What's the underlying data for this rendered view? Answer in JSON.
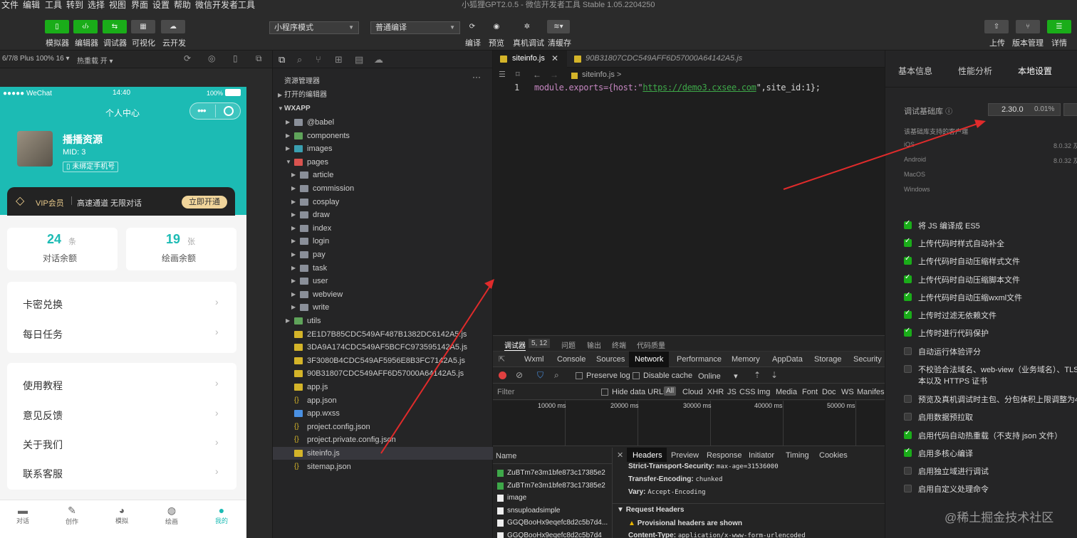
{
  "menu": [
    "文件",
    "编辑",
    "工具",
    "转到",
    "选择",
    "视图",
    "界面",
    "设置",
    "帮助",
    "微信开发者工具"
  ],
  "window_title": "小狐狸GPT2.0.5 - 微信开发者工具 Stable 1.05.2204250",
  "toolbar": {
    "left_buttons": [
      "模拟器",
      "编辑器",
      "调试器",
      "可视化",
      "云开发"
    ],
    "mode_select": "小程序模式",
    "compile_select": "普通编译",
    "mid_buttons": [
      "编译",
      "预览",
      "真机调试",
      "清缓存"
    ],
    "right_buttons": [
      "上传",
      "版本管理",
      "详情"
    ]
  },
  "simulator": {
    "device": "6/7/8 Plus 100% 16",
    "hot_reload": "热重载 开",
    "status_carrier": "●●●●● WeChat",
    "status_time": "14:40",
    "status_battery": "100%",
    "nav_title": "个人中心",
    "profile_name": "播播资源",
    "profile_mid": "MID: 3",
    "bind_phone": "未绑定手机号",
    "vip_label": "VIP会员",
    "vip_desc": "高速通道 无限对话",
    "vip_button": "立即开通",
    "stat1_value": "24",
    "stat1_unit": "条",
    "stat1_label": "对话余额",
    "stat2_value": "19",
    "stat2_unit": "张",
    "stat2_label": "绘画余额",
    "menu_group1": [
      "卡密兑换",
      "每日任务"
    ],
    "menu_group2": [
      "使用教程",
      "意见反馈",
      "关于我们",
      "联系客服"
    ],
    "tabbar": [
      "对话",
      "创作",
      "模拟",
      "绘画",
      "我的"
    ]
  },
  "explorer": {
    "title": "资源管理器",
    "open_editors": "打开的编辑器",
    "project": "WXAPP",
    "tree": [
      {
        "name": "@babel",
        "level": 1,
        "type": "folder"
      },
      {
        "name": "components",
        "level": 1,
        "type": "folder-green"
      },
      {
        "name": "images",
        "level": 1,
        "type": "folder-img"
      },
      {
        "name": "pages",
        "level": 1,
        "type": "folder-red",
        "open": true
      },
      {
        "name": "article",
        "level": 2,
        "type": "folder"
      },
      {
        "name": "commission",
        "level": 2,
        "type": "folder"
      },
      {
        "name": "cosplay",
        "level": 2,
        "type": "folder"
      },
      {
        "name": "draw",
        "level": 2,
        "type": "folder"
      },
      {
        "name": "index",
        "level": 2,
        "type": "folder"
      },
      {
        "name": "login",
        "level": 2,
        "type": "folder"
      },
      {
        "name": "pay",
        "level": 2,
        "type": "folder"
      },
      {
        "name": "task",
        "level": 2,
        "type": "folder"
      },
      {
        "name": "user",
        "level": 2,
        "type": "folder"
      },
      {
        "name": "webview",
        "level": 2,
        "type": "folder"
      },
      {
        "name": "write",
        "level": 2,
        "type": "folder"
      },
      {
        "name": "utils",
        "level": 1,
        "type": "folder-green"
      },
      {
        "name": "2E1D7B85CDC549AF487B1382DC6142A5.js",
        "level": 1,
        "type": "js"
      },
      {
        "name": "3DA9A174CDC549AF5BCFC973595142A5.js",
        "level": 1,
        "type": "js"
      },
      {
        "name": "3F3080B4CDC549AF5956E8B3FC7142A5.js",
        "level": 1,
        "type": "js"
      },
      {
        "name": "90B31807CDC549AFF6D57000A64142A5.js",
        "level": 1,
        "type": "js"
      },
      {
        "name": "app.js",
        "level": 1,
        "type": "js"
      },
      {
        "name": "app.json",
        "level": 1,
        "type": "json"
      },
      {
        "name": "app.wxss",
        "level": 1,
        "type": "css"
      },
      {
        "name": "project.config.json",
        "level": 1,
        "type": "json"
      },
      {
        "name": "project.private.config.json",
        "level": 1,
        "type": "json"
      },
      {
        "name": "siteinfo.js",
        "level": 1,
        "type": "js",
        "selected": true
      },
      {
        "name": "sitemap.json",
        "level": 1,
        "type": "json"
      }
    ]
  },
  "editor": {
    "tab1": "siteinfo.js",
    "tab2": "90B31807CDC549AFF6D57000A64142A5.js",
    "breadcrumb": "siteinfo.js >",
    "line_no": "1",
    "code_a": "module.exports={host:\"",
    "code_url": "https://demo3.cxsee.com",
    "code_b": "\",site_id:1};"
  },
  "devtools": {
    "top_tabs": [
      "调试器",
      "5, 12",
      "问题",
      "输出",
      "终端",
      "代码质量"
    ],
    "tabs": [
      "Wxml",
      "Console",
      "Sources",
      "Network",
      "Performance",
      "Memory",
      "AppData",
      "Storage",
      "Security"
    ],
    "preserve_log": "Preserve log",
    "disable_cache": "Disable cache",
    "online": "Online",
    "filter": "Filter",
    "hide_data_urls": "Hide data URLs",
    "filter_types": [
      "All",
      "Cloud",
      "XHR",
      "JS",
      "CSS",
      "Img",
      "Media",
      "Font",
      "Doc",
      "WS",
      "Manifest"
    ],
    "timeline": [
      "10000 ms",
      "20000 ms",
      "30000 ms",
      "40000 ms",
      "50000 ms"
    ],
    "name_header": "Name",
    "requests": [
      "ZuBTm7e3m1bfe873c17385e2",
      "ZuBTm7e3m1bfe873c17385e2",
      "image",
      "snsuploadsimple",
      "GGQBooHx9eqefc8d2c5b7d4...",
      "GGQBooHx9eqefc8d2c5b7d4"
    ],
    "detail_tabs": [
      "Headers",
      "Preview",
      "Response",
      "Initiator",
      "Timing",
      "Cookies"
    ],
    "headers": [
      {
        "k": "Strict-Transport-Security:",
        "v": "max-age=31536000"
      },
      {
        "k": "Transfer-Encoding:",
        "v": "chunked"
      },
      {
        "k": "Vary:",
        "v": "Accept-Encoding"
      }
    ],
    "request_headers": "Request Headers",
    "provisional": "Provisional headers are shown",
    "content_type_k": "Content-Type:",
    "content_type_v": "application/x-www-form-urlencoded"
  },
  "rightpanel": {
    "tabs": [
      "基本信息",
      "性能分析",
      "本地设置"
    ],
    "lib_label": "调试基础库",
    "lib_version": "2.30.0",
    "lib_percent": "0.01%",
    "support_text": "该基础库支持的客户端",
    "platforms": [
      {
        "name": "iOS",
        "ver": "8.0.32 及"
      },
      {
        "name": "Android",
        "ver": "8.0.32 及"
      },
      {
        "name": "MacOS",
        "ver": ""
      },
      {
        "name": "Windows",
        "ver": ""
      }
    ],
    "options": [
      {
        "label": "将 JS 编译成 ES5",
        "on": true
      },
      {
        "label": "上传代码时样式自动补全",
        "on": true
      },
      {
        "label": "上传代码时自动压缩样式文件",
        "on": true
      },
      {
        "label": "上传代码时自动压缩脚本文件",
        "on": true
      },
      {
        "label": "上传代码时自动压缩wxml文件",
        "on": true
      },
      {
        "label": "上传时过滤无依赖文件",
        "on": true
      },
      {
        "label": "上传时进行代码保护",
        "on": true
      },
      {
        "label": "自动运行体验评分",
        "on": false
      },
      {
        "label": "不校验合法域名、web-view（业务域名）、TLS",
        "label2": "本以及 HTTPS 证书",
        "on": false
      },
      {
        "label": "预览及真机调试时主包、分包体积上限调整为4",
        "on": false
      },
      {
        "label": "启用数据预拉取",
        "on": false
      },
      {
        "label": "启用代码自动热重载（不支持 json 文件）",
        "on": true
      },
      {
        "label": "启用多核心编译",
        "on": true
      },
      {
        "label": "启用独立域进行调试",
        "on": false
      },
      {
        "label": "启用自定义处理命令",
        "on": false
      }
    ]
  },
  "watermark": "@稀土掘金技术社区",
  "colors": {
    "accent_green": "#1aad19",
    "teal": "#1cbbb4",
    "url_green": "#3ea849",
    "arrow_red": "#e02b2b"
  }
}
